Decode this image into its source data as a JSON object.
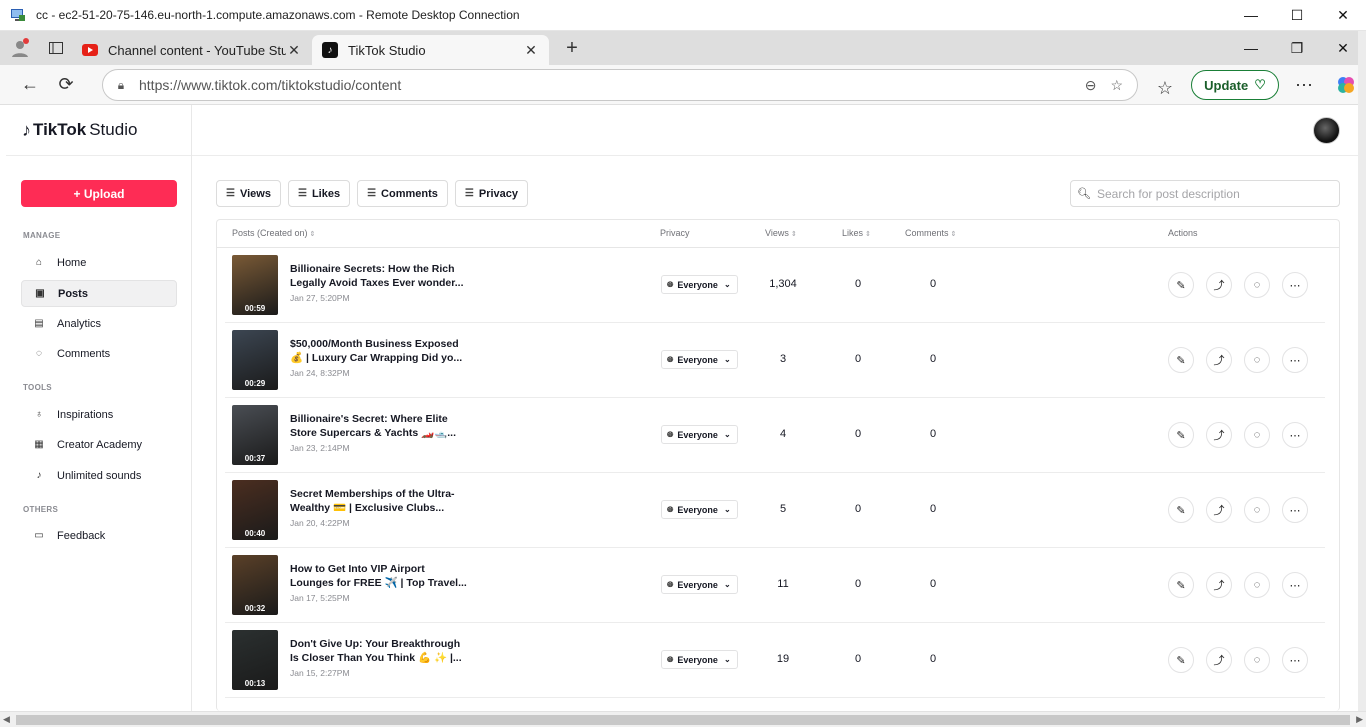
{
  "rdp": {
    "title": "cc - ec2-51-20-75-146.eu-north-1.compute.amazonaws.com - Remote Desktop Connection",
    "minimize": "—",
    "maximize": "☐",
    "close": "✕"
  },
  "browser": {
    "tabs": [
      {
        "label": "Channel content - YouTube Studio",
        "favicon": "youtube-icon",
        "active": false
      },
      {
        "label": "TikTok Studio",
        "favicon": "tiktok-icon",
        "active": true
      }
    ],
    "tab_close": "✕",
    "new_tab": "+",
    "window_minimize": "—",
    "window_restore": "❐",
    "window_close": "✕",
    "url": "https://www.tiktok.com/tiktokstudio/content",
    "update_label": "Update"
  },
  "app": {
    "brand": "TikTok",
    "brand_suffix": "Studio",
    "upload_label": "+ Upload",
    "sections": {
      "manage": "MANAGE",
      "tools": "TOOLS",
      "others": "OTHERS"
    },
    "nav": {
      "home": "Home",
      "posts": "Posts",
      "analytics": "Analytics",
      "comments": "Comments",
      "inspirations": "Inspirations",
      "creator_academy": "Creator Academy",
      "unlimited_sounds": "Unlimited sounds",
      "feedback": "Feedback"
    },
    "filters": {
      "views": "Views",
      "likes": "Likes",
      "comments": "Comments",
      "privacy": "Privacy"
    },
    "search_placeholder": "Search for post description",
    "columns": {
      "posts": "Posts (Created on)",
      "privacy": "Privacy",
      "views": "Views",
      "likes": "Likes",
      "comments": "Comments",
      "actions": "Actions"
    },
    "privacy_label": "Everyone",
    "posts": [
      {
        "title": "Billionaire Secrets: How the Rich Legally Avoid Taxes Ever wonder...",
        "date": "Jan 27, 5:20PM",
        "duration": "00:59",
        "views": "1,304",
        "likes": "0",
        "comments": "0",
        "color": "#7a5a36"
      },
      {
        "title": "$50,000/Month Business Exposed 💰 | Luxury Car Wrapping Did yo...",
        "date": "Jan 24, 8:32PM",
        "duration": "00:29",
        "views": "3",
        "likes": "0",
        "comments": "0",
        "color": "#3c4652"
      },
      {
        "title": "Billionaire's Secret: Where Elite Store Supercars & Yachts 🏎️🛥️...",
        "date": "Jan 23, 2:14PM",
        "duration": "00:37",
        "views": "4",
        "likes": "0",
        "comments": "0",
        "color": "#4a4e54"
      },
      {
        "title": "Secret Memberships of the Ultra-Wealthy 💳 | Exclusive Clubs...",
        "date": "Jan 20, 4:22PM",
        "duration": "00:40",
        "views": "5",
        "likes": "0",
        "comments": "0",
        "color": "#4b2e20"
      },
      {
        "title": "How to Get Into VIP Airport Lounges for FREE ✈️ | Top Travel...",
        "date": "Jan 17, 5:25PM",
        "duration": "00:32",
        "views": "11",
        "likes": "0",
        "comments": "0",
        "color": "#5a4028"
      },
      {
        "title": "Don't Give Up: Your Breakthrough Is Closer Than You Think 💪 ✨ |...",
        "date": "Jan 15, 2:27PM",
        "duration": "00:13",
        "views": "19",
        "likes": "0",
        "comments": "0",
        "color": "#2b3030"
      }
    ]
  },
  "colors": {
    "accent": "#fe2c55",
    "update_green": "#1a7f37"
  }
}
